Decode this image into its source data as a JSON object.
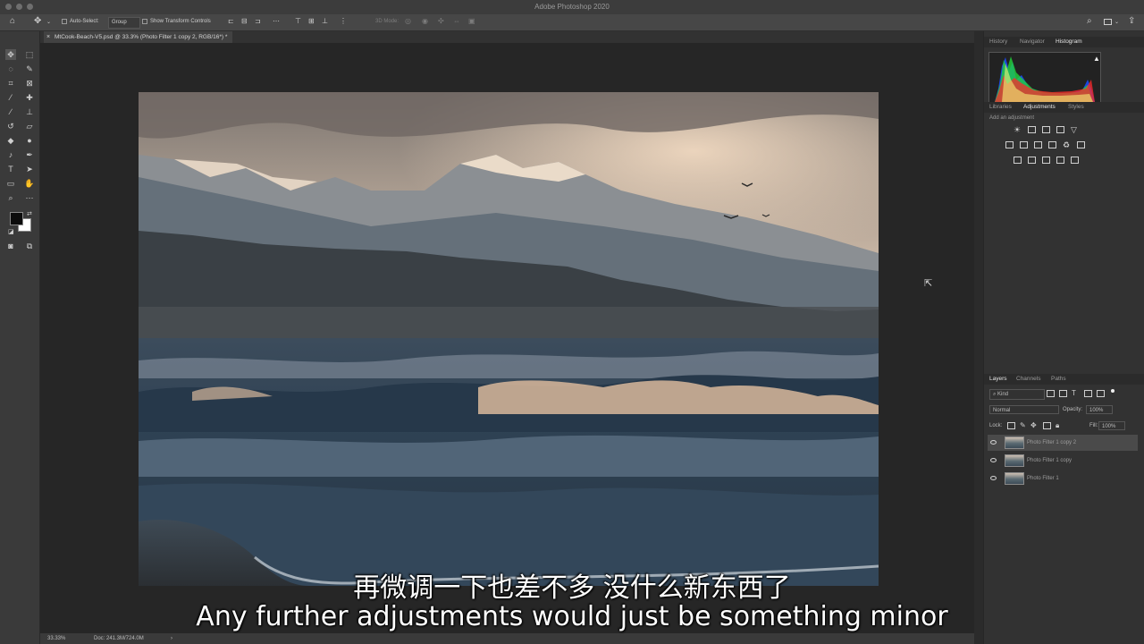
{
  "app": {
    "title": "Adobe Photoshop 2020"
  },
  "options_bar": {
    "auto_select_label": "Auto-Select:",
    "auto_select_value": "Group",
    "show_transform_label": "Show Transform Controls",
    "mode_3d_label": "3D Mode:"
  },
  "document": {
    "tab_title": "MtCook-Beach-V5.psd @ 33.3% (Photo Filter 1 copy 2, RGB/16*) *"
  },
  "status_bar": {
    "zoom": "33.33%",
    "doc_info": "Doc: 241.3M/724.0M"
  },
  "panels": {
    "top_tabs": [
      "History",
      "Navigator",
      "Histogram"
    ],
    "top_active": "Histogram",
    "mid_tabs": [
      "Libraries",
      "Adjustments",
      "Styles"
    ],
    "mid_active": "Adjustments",
    "add_adjustment_label": "Add an adjustment",
    "layer_tabs": [
      "Layers",
      "Channels",
      "Paths"
    ],
    "layer_active": "Layers",
    "kind_label": "Kind",
    "blend_mode": "Normal",
    "opacity_label": "Opacity:",
    "opacity_value": "100%",
    "lock_label": "Lock:",
    "fill_label": "Fill:",
    "fill_value": "100%",
    "layers": [
      {
        "name": "Photo Filter 1 copy 2",
        "selected": true
      },
      {
        "name": "Photo Filter 1 copy",
        "selected": false
      },
      {
        "name": "Photo Filter 1",
        "selected": false
      }
    ]
  },
  "subtitles": {
    "chinese": "再微调一下也差不多 没什么新东西了",
    "english": "Any further adjustments would just be something minor"
  }
}
